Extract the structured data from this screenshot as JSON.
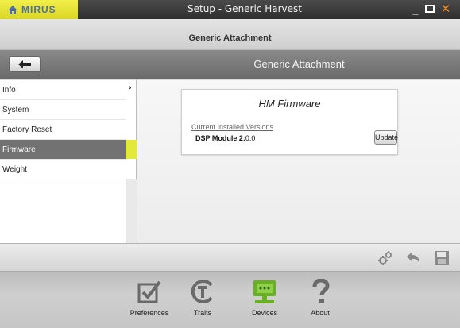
{
  "app": {
    "logo_text": "MIRUS",
    "window_title": "Setup  - Generic Harvest",
    "subheader_title": "Generic Attachment",
    "nav_title": "Generic Attachment"
  },
  "window_controls": {
    "minimize": "_",
    "maximize": "▫",
    "close": "✕"
  },
  "sidebar": {
    "items": [
      {
        "label": "Info"
      },
      {
        "label": "System"
      },
      {
        "label": "Factory Reset"
      },
      {
        "label": "Firmware",
        "active": true
      },
      {
        "label": "Weight"
      }
    ]
  },
  "card": {
    "title": "HM Firmware",
    "subtitle": "Current Installed Versions",
    "row_label": "DSP Module 2:",
    "row_value": "0.0",
    "update_label": "Update"
  },
  "dock": {
    "items": [
      {
        "label": "Preferences",
        "icon": "checklist-icon"
      },
      {
        "label": "Traits",
        "icon": "traits-icon"
      },
      {
        "label": "Devices",
        "icon": "devices-icon"
      },
      {
        "label": "About",
        "icon": "question-icon"
      }
    ]
  },
  "colors": {
    "accent_yellow": "#e4e83a",
    "devices_green": "#6ab023",
    "logo_blue": "#4e6fa0",
    "close_orange": "#f28a1e"
  }
}
